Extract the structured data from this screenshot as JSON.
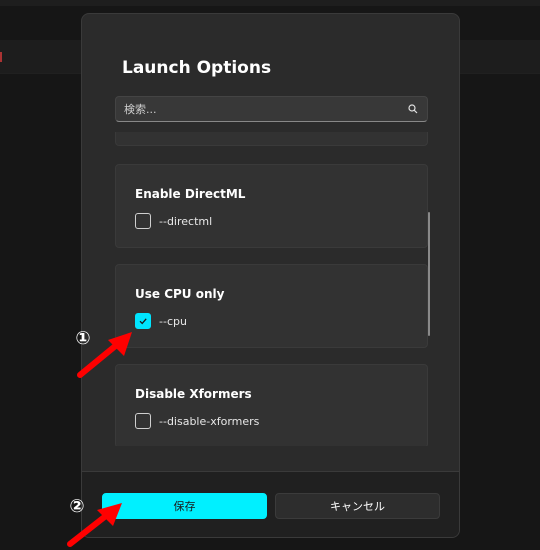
{
  "dialog": {
    "title": "Launch Options",
    "search": {
      "placeholder": "検索..."
    },
    "options": [
      {
        "title": "Enable DirectML",
        "flag": "--directml",
        "checked": false
      },
      {
        "title": "Use CPU only",
        "flag": "--cpu",
        "checked": true
      },
      {
        "title": "Disable Xformers",
        "flag": "--disable-xformers",
        "checked": false
      }
    ],
    "footer": {
      "save_label": "保存",
      "cancel_label": "キャンセル"
    }
  },
  "annotations": [
    {
      "label": "①"
    },
    {
      "label": "②"
    }
  ],
  "colors": {
    "accent": "#00f0ff",
    "dialog_bg": "#2b2b2b",
    "card_bg": "#323232",
    "arrow": "#ff0000"
  },
  "icons": {
    "search": "search-icon",
    "check": "check-icon",
    "arrow": "red-arrow-icon"
  }
}
